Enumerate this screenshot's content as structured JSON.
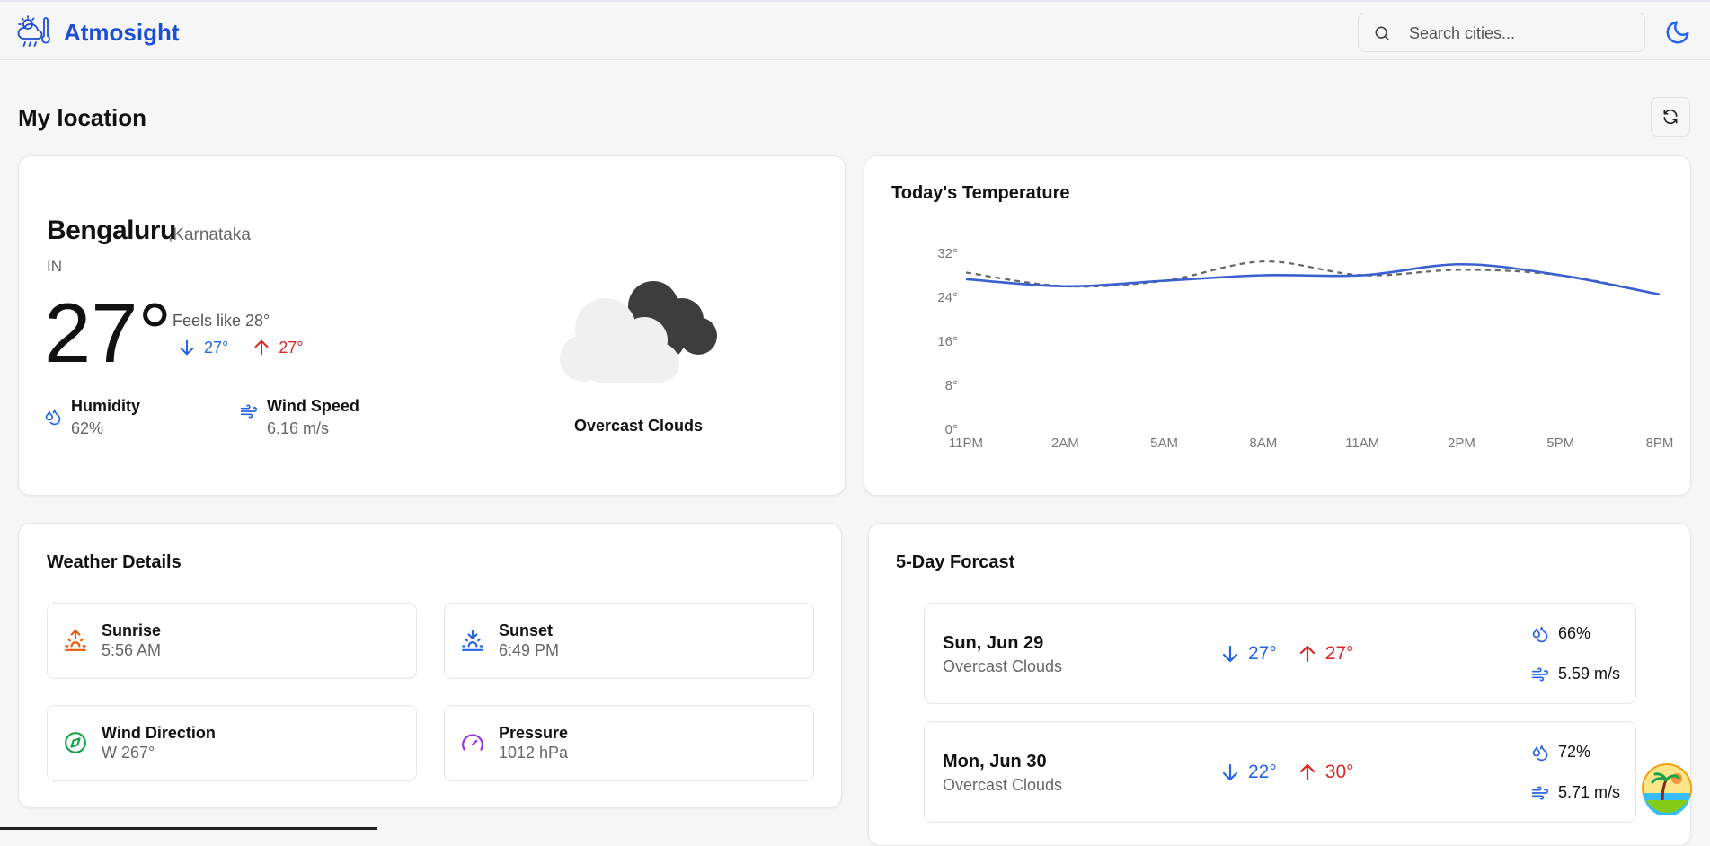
{
  "app": {
    "name": "Atmosight"
  },
  "header": {
    "search_placeholder": "Search cities...",
    "theme_icon": "moon-icon"
  },
  "page": {
    "title": "My location",
    "refresh_icon": "refresh-icon"
  },
  "current": {
    "city": "Bengaluru",
    "region": ",Karnataka",
    "country": "IN",
    "temp": "27°",
    "feels_like": "Feels like 28°",
    "min": "27°",
    "max": "27°",
    "humidity_label": "Humidity",
    "humidity": "62%",
    "wind_label": "Wind Speed",
    "wind": "6.16 m/s",
    "condition": "Overcast Clouds",
    "condition_icon": "overcast-clouds-icon"
  },
  "temperature_card": {
    "title": "Today's Temperature"
  },
  "chart_data": {
    "type": "line",
    "title": "Today's Temperature",
    "x": [
      "11PM",
      "2AM",
      "5AM",
      "8AM",
      "11AM",
      "2PM",
      "5PM",
      "8PM"
    ],
    "yticks": [
      "0°",
      "8°",
      "16°",
      "24°",
      "32°"
    ],
    "ylim": [
      0,
      32
    ],
    "grid": false,
    "series": [
      {
        "style": "solid",
        "color": "#3b5fce",
        "values": [
          27.3,
          26.0,
          27.0,
          28.0,
          28.0,
          30.0,
          28.0,
          24.5
        ]
      },
      {
        "style": "dashed",
        "color": "#666666",
        "values": [
          28.5,
          26.0,
          27.0,
          30.5,
          28.0,
          29.0,
          28.0,
          24.5
        ]
      }
    ]
  },
  "details": {
    "title": "Weather Details",
    "items": [
      {
        "label": "Sunrise",
        "value": "5:56 AM",
        "icon": "sunrise-icon",
        "color": "#ea580c"
      },
      {
        "label": "Sunset",
        "value": "6:49 PM",
        "icon": "sunset-icon",
        "color": "#2563eb"
      },
      {
        "label": "Wind Direction",
        "value": "W 267°",
        "icon": "compass-icon",
        "color": "#16a34a"
      },
      {
        "label": "Pressure",
        "value": "1012 hPa",
        "icon": "gauge-icon",
        "color": "#9333ea"
      }
    ]
  },
  "forecast": {
    "title": "5-Day Forcast",
    "days": [
      {
        "date": "Sun, Jun 29",
        "desc": "Overcast Clouds",
        "min": "27°",
        "max": "27°",
        "humidity": "66%",
        "wind": "5.59 m/s"
      },
      {
        "date": "Mon, Jun 30",
        "desc": "Overcast Clouds",
        "min": "22°",
        "max": "30°",
        "humidity": "72%",
        "wind": "5.71 m/s"
      }
    ]
  },
  "colors": {
    "accent": "#1d4ed8",
    "cold": "#2563eb",
    "hot": "#dc2626"
  }
}
